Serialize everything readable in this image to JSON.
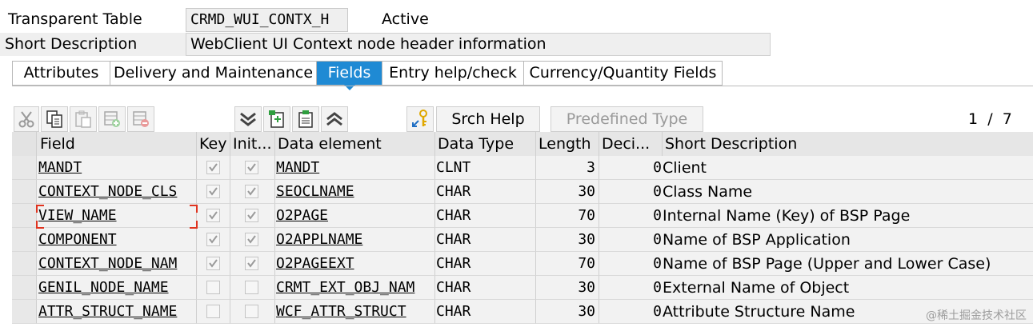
{
  "header": {
    "table_type_label": "Transparent Table",
    "table_name": "CRMD_WUI_CONTX_H",
    "status": "Active",
    "short_desc_label": "Short Description",
    "short_desc_value": "WebClient UI Context node header information"
  },
  "tabs": [
    {
      "label": "Attributes",
      "active": false
    },
    {
      "label": "Delivery and Maintenance",
      "active": false
    },
    {
      "label": "Fields",
      "active": true
    },
    {
      "label": "Entry help/check",
      "active": false
    },
    {
      "label": "Currency/Quantity Fields",
      "active": false
    }
  ],
  "toolbar": {
    "icons": [
      "cut-icon",
      "copy-icon",
      "paste-icon",
      "insert-row-icon",
      "delete-row-icon",
      "scroll-down-icon",
      "new-entry-icon",
      "details-icon",
      "scroll-up-icon",
      "search-help-icon"
    ],
    "srch_help_label": "Srch Help",
    "predefined_type_label": "Predefined Type",
    "page_current": "1",
    "page_separator": "/",
    "page_total": "7"
  },
  "table": {
    "columns": {
      "field": "Field",
      "key": "Key",
      "init": "Init...",
      "data_element": "Data element",
      "data_type": "Data Type",
      "length": "Length",
      "decimals": "Deci...",
      "short_description": "Short Description"
    },
    "rows": [
      {
        "field": "MANDT",
        "key": true,
        "init": true,
        "data_element": "MANDT",
        "data_type": "CLNT",
        "length": "3",
        "decimals": "0",
        "short_description": "Client"
      },
      {
        "field": "CONTEXT_NODE_CLS",
        "key": true,
        "init": true,
        "data_element": "SEOCLNAME",
        "data_type": "CHAR",
        "length": "30",
        "decimals": "0",
        "short_description": "Class Name"
      },
      {
        "field": "VIEW_NAME",
        "key": true,
        "init": true,
        "data_element": "O2PAGE",
        "data_type": "CHAR",
        "length": "70",
        "decimals": "0",
        "short_description": "Internal Name (Key) of BSP Page"
      },
      {
        "field": "COMPONENT",
        "key": true,
        "init": true,
        "data_element": "O2APPLNAME",
        "data_type": "CHAR",
        "length": "30",
        "decimals": "0",
        "short_description": "Name of BSP Application"
      },
      {
        "field": "CONTEXT_NODE_NAM",
        "key": true,
        "init": true,
        "data_element": "O2PAGEEXT",
        "data_type": "CHAR",
        "length": "70",
        "decimals": "0",
        "short_description": "Name of BSP Page (Upper and Lower Case)"
      },
      {
        "field": "GENIL_NODE_NAME",
        "key": false,
        "init": false,
        "data_element": "CRMT_EXT_OBJ_NAM",
        "data_type": "CHAR",
        "length": "30",
        "decimals": "0",
        "short_description": "External Name of Object"
      },
      {
        "field": "ATTR_STRUCT_NAME",
        "key": false,
        "init": false,
        "data_element": "WCF_ATTR_STRUCT",
        "data_type": "CHAR",
        "length": "30",
        "decimals": "0",
        "short_description": "Attribute Structure Name"
      }
    ]
  },
  "watermark": "@稀土掘金技术社区",
  "colors": {
    "active_tab": "#1f8ad4",
    "focus_marker": "#e0331f"
  }
}
